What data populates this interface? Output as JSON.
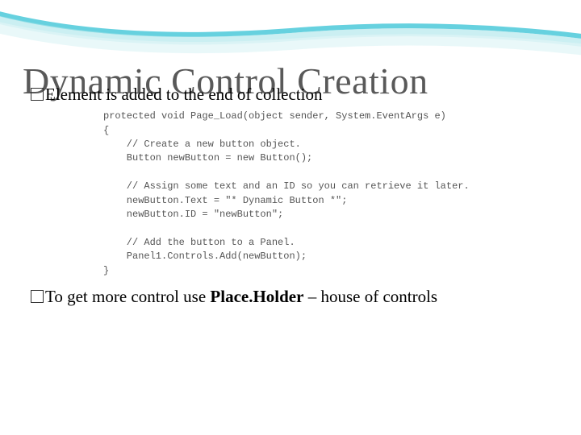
{
  "title": "Dynamic Control Creation",
  "bullets": {
    "b1_prefix": "Element is added to the end of collection",
    "b2_prefix": "To get more control use ",
    "b2_bold": "Place.Holder",
    "b2_suffix": " – house of controls"
  },
  "code": {
    "l1": "protected void Page_Load(object sender, System.EventArgs e)",
    "l2": "{",
    "l3": "    // Create a new button object.",
    "l4": "    Button newButton = new Button();",
    "l5": "",
    "l6": "    // Assign some text and an ID so you can retrieve it later.",
    "l7": "    newButton.Text = \"* Dynamic Button *\";",
    "l8": "    newButton.ID = \"newButton\";",
    "l9": "",
    "l10": "    // Add the button to a Panel.",
    "l11": "    Panel1.Controls.Add(newButton);",
    "l12": "}"
  }
}
